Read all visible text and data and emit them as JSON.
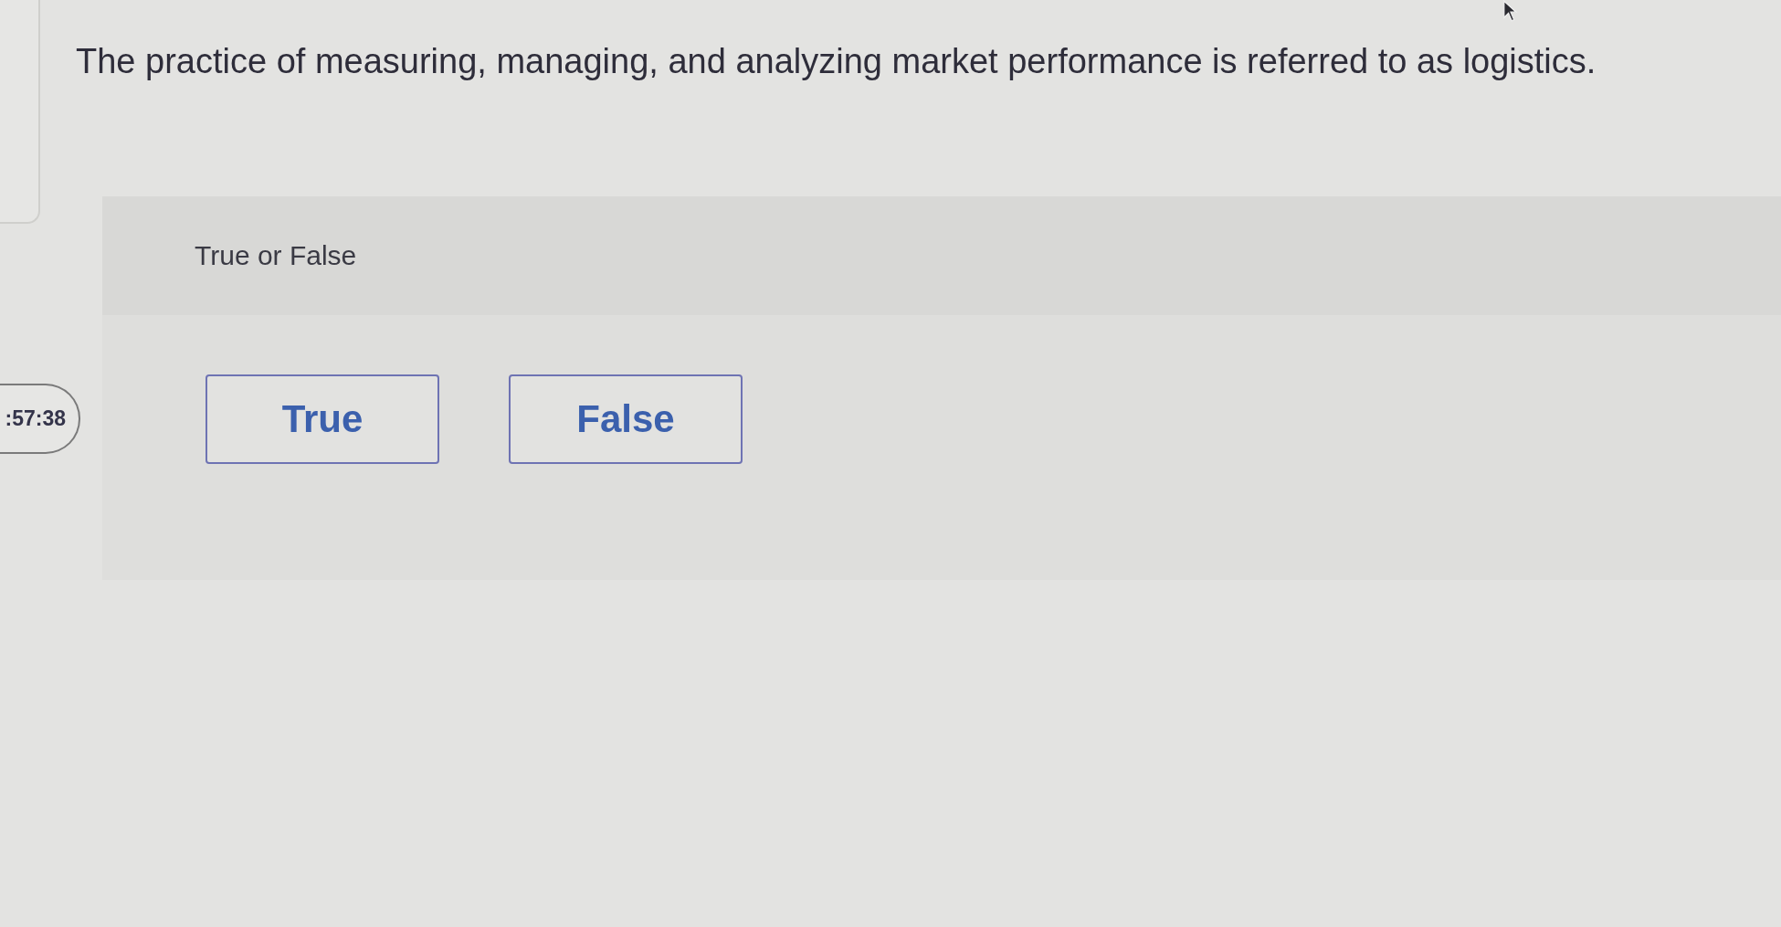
{
  "question": {
    "text": "The practice of measuring, managing, and analyzing market performance is referred to as logistics."
  },
  "timer": {
    "text": ":57:38"
  },
  "answer_panel": {
    "prompt": "True or False",
    "options": [
      {
        "label": "True",
        "selected": false
      },
      {
        "label": "False",
        "selected": false
      }
    ]
  }
}
